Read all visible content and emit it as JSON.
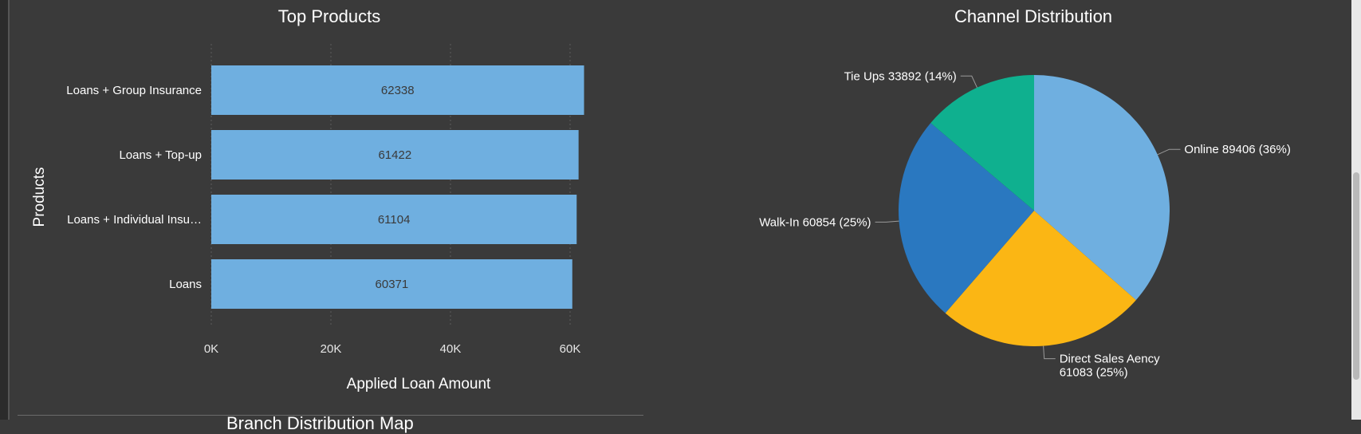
{
  "next_panel": {
    "title": "Branch Distribution Map"
  },
  "chart_data": [
    {
      "type": "bar",
      "orientation": "horizontal",
      "title": "Top Products",
      "xlabel": "Applied Loan Amount",
      "ylabel": "Products",
      "categories": [
        "Loans + Group Insurance",
        "Loans + Top-up",
        "Loans + Individual Insu…",
        "Loans"
      ],
      "values": [
        62338,
        61422,
        61104,
        60371
      ],
      "xlim": [
        0,
        60000
      ],
      "xticks": [
        "0K",
        "20K",
        "40K",
        "60K"
      ],
      "grid": true,
      "colors": {
        "bar": "#6fafe0"
      }
    },
    {
      "type": "pie",
      "title": "Channel Distribution",
      "slices": [
        {
          "label": "Online 89406 (36%)",
          "value": 89406,
          "color": "#6fafe0"
        },
        {
          "label": "Direct Sales Aency 61083 (25%)",
          "value": 61083,
          "color": "#fbb614"
        },
        {
          "label": "Walk-In 60854 (25%)",
          "value": 60854,
          "color": "#2a78c0"
        },
        {
          "label": "Tie Ups 33892 (14%)",
          "value": 33892,
          "color": "#0fb08f"
        }
      ]
    }
  ]
}
